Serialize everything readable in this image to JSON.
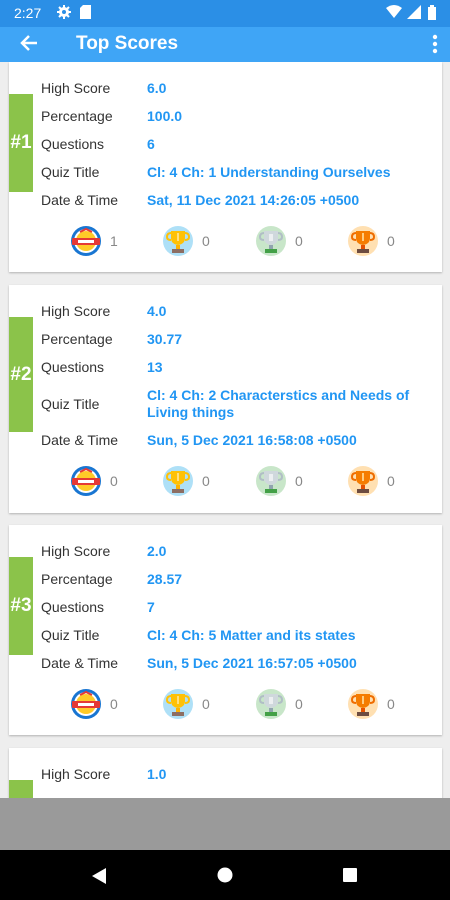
{
  "status_bar": {
    "time": "2:27"
  },
  "app_bar": {
    "title": "Top Scores"
  },
  "labels": {
    "high_score": "High Score",
    "percentage": "Percentage",
    "questions": "Questions",
    "quiz_title": "Quiz Title",
    "date_time": "Date & Time"
  },
  "badge_icons": [
    "best-score-badge-icon",
    "gold-trophy-icon",
    "silver-trophy-icon",
    "bronze-trophy-icon"
  ],
  "colors": {
    "status_bar": "#2b8fe6",
    "app_bar": "#3fa5f6",
    "rank_bar": "#8bc34a",
    "value_text": "#2196f3"
  },
  "cards": [
    {
      "rank": "#1",
      "high_score": "6.0",
      "percentage": "100.0",
      "questions": "6",
      "quiz_title": "Cl: 4 Ch: 1 Understanding Ourselves",
      "date_time": "Sat, 11 Dec 2021 14:26:05 +0500",
      "badge_counts": [
        "1",
        "0",
        "0",
        "0"
      ]
    },
    {
      "rank": "#2",
      "high_score": "4.0",
      "percentage": "30.77",
      "questions": "13",
      "quiz_title": "Cl: 4 Ch: 2 Characterstics and Needs of Living things",
      "date_time": "Sun, 5 Dec 2021 16:58:08 +0500",
      "badge_counts": [
        "0",
        "0",
        "0",
        "0"
      ]
    },
    {
      "rank": "#3",
      "high_score": "2.0",
      "percentage": "28.57",
      "questions": "7",
      "quiz_title": "Cl: 4 Ch: 5 Matter and its states",
      "date_time": "Sun, 5 Dec 2021 16:57:05 +0500",
      "badge_counts": [
        "0",
        "0",
        "0",
        "0"
      ]
    },
    {
      "high_score": "1.0"
    }
  ]
}
